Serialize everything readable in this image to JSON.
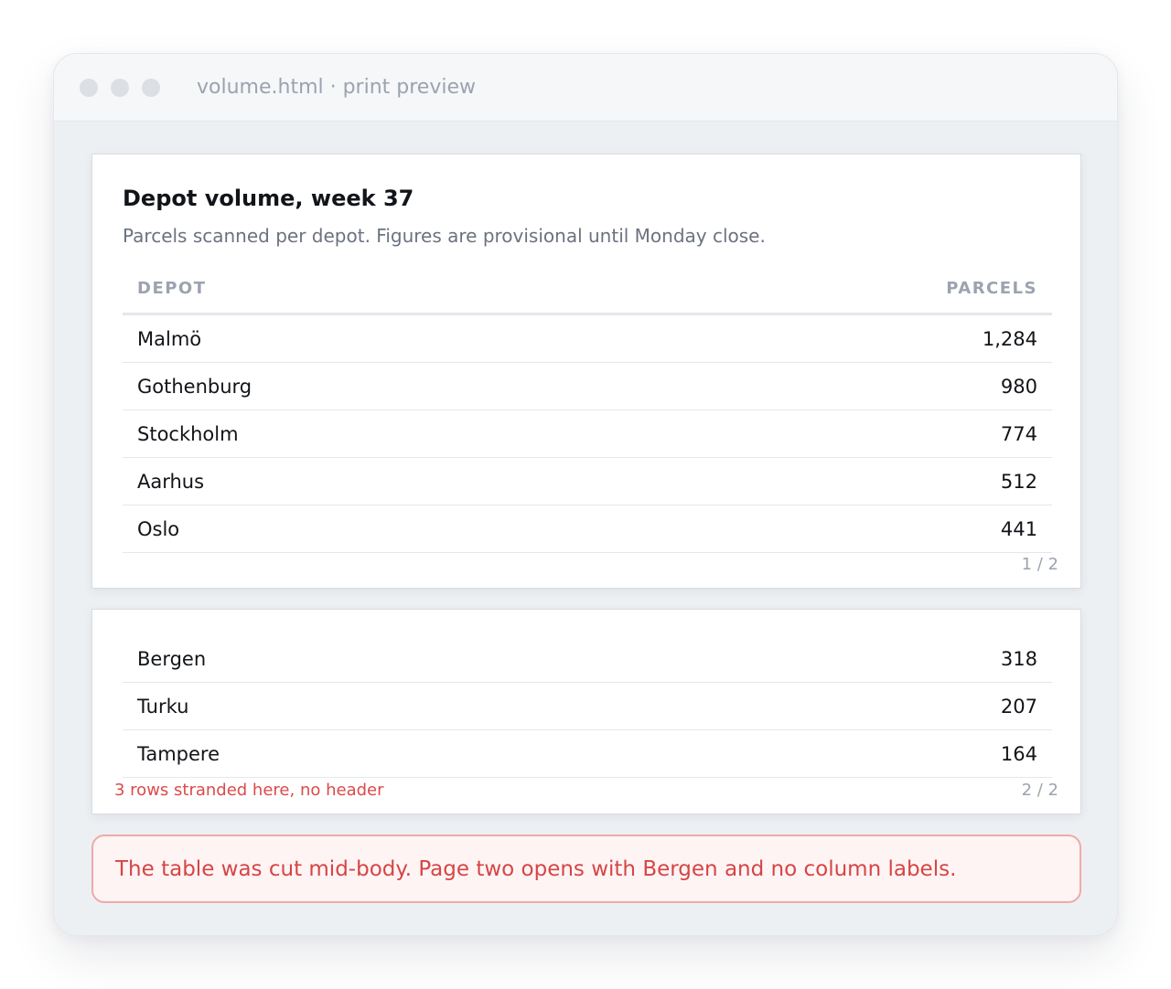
{
  "window": {
    "title": "volume.html · print preview"
  },
  "page1": {
    "title": "Depot volume, week 37",
    "subtitle": "Parcels scanned per depot. Figures are provisional until Monday close.",
    "columns": {
      "depot": "DEPOT",
      "parcels": "PARCELS"
    },
    "rows": [
      {
        "depot": "Malmö",
        "parcels": "1,284"
      },
      {
        "depot": "Gothenburg",
        "parcels": "980"
      },
      {
        "depot": "Stockholm",
        "parcels": "774"
      },
      {
        "depot": "Aarhus",
        "parcels": "512"
      },
      {
        "depot": "Oslo",
        "parcels": "441"
      }
    ],
    "page_number": "1 / 2"
  },
  "page2": {
    "rows": [
      {
        "depot": "Bergen",
        "parcels": "318"
      },
      {
        "depot": "Turku",
        "parcels": "207"
      },
      {
        "depot": "Tampere",
        "parcels": "164"
      }
    ],
    "note": "3 rows stranded here, no header",
    "page_number": "2 / 2"
  },
  "warning": {
    "text": "The table was cut mid-body. Page two opens with Bergen and no column labels."
  },
  "colors": {
    "warning_text": "#d64545",
    "warning_border": "#f0a9a9",
    "warning_bg": "#fff4f4",
    "muted": "#9ca3af"
  }
}
